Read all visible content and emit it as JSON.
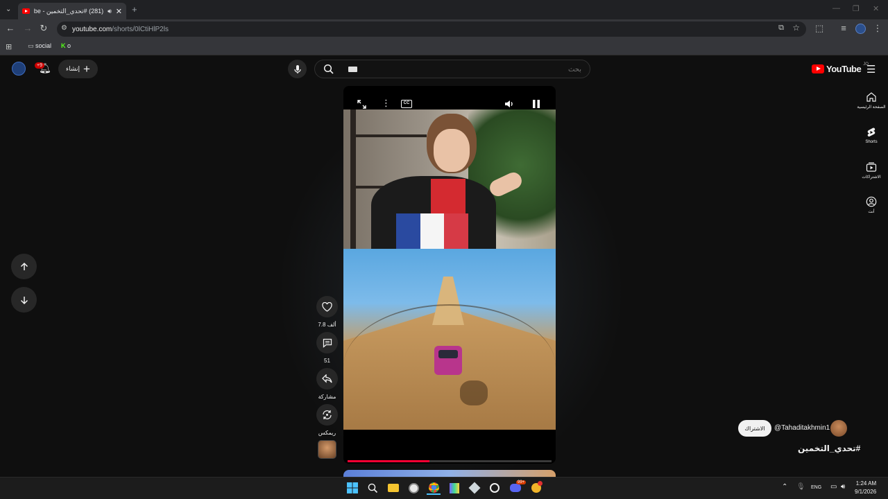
{
  "browser": {
    "tab_title": "(281) #تحدي_التخمين - YouTube",
    "url_host": "youtube.com",
    "url_path": "/shorts/0lCtiHlP2ls",
    "bookmarks": [
      {
        "label": "social",
        "icon": "folder-icon"
      },
      {
        "label": "o",
        "icon": "k-logo-icon"
      }
    ]
  },
  "youtube": {
    "logo_text": "YouTube",
    "logo_region": "JO",
    "search_placeholder": "بحث",
    "search_value": "",
    "create_label": "إنشاء",
    "notifications_badge": "+9",
    "nav": [
      {
        "label": "الصفحة الرئيسية",
        "icon": "home-icon"
      },
      {
        "label": "Shorts",
        "icon": "shorts-icon"
      },
      {
        "label": "الاشتراكات",
        "icon": "subscriptions-icon"
      },
      {
        "label": "أنت",
        "icon": "you-icon"
      }
    ]
  },
  "short": {
    "progress": 0.4,
    "actions": {
      "likes": "7.8 ألف",
      "comments": "51",
      "share": "مشاركة",
      "remix": "ريمكس"
    },
    "channel_handle": "@Tahaditakhmin1",
    "subscribe_label": "الاشتراك",
    "hashtag": "#تحدي_التخمين"
  },
  "taskbar": {
    "lang": "ENG",
    "time": "1:24 AM",
    "date": "9/1/2026",
    "discord_badge": "99+"
  },
  "colors": {
    "accent": "#ff0000",
    "progress": "#ff0033",
    "background": "#0f0f0f"
  }
}
